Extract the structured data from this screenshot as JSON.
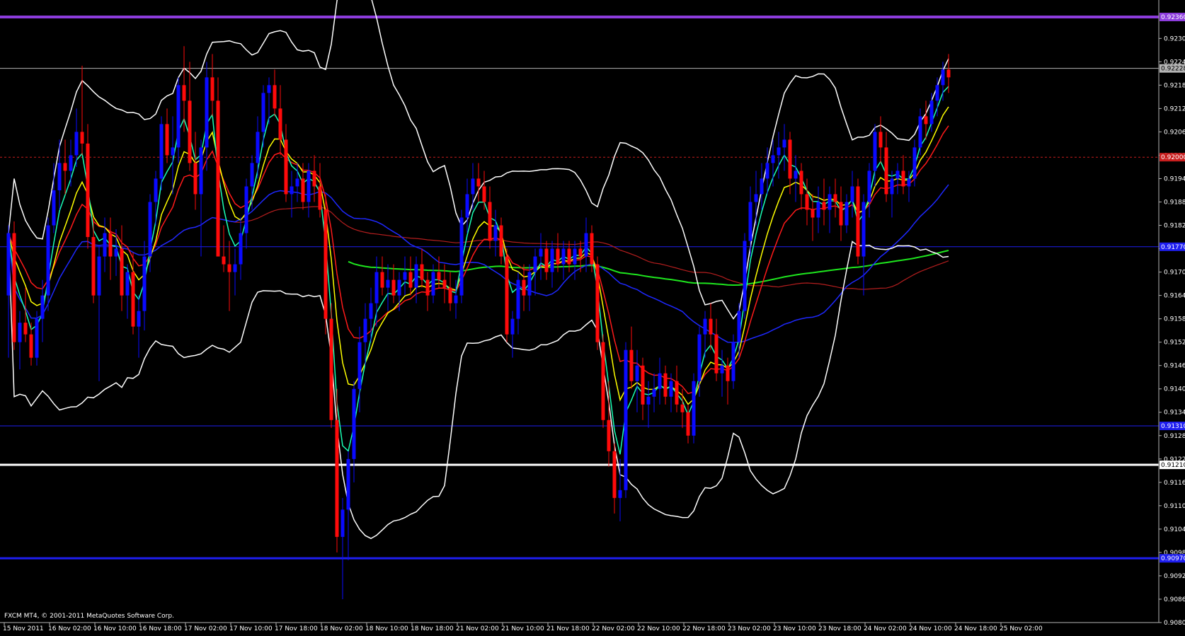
{
  "window": {
    "copyright": "FXCM MT4, © 2001-2011 MetaQuotes Software Corp."
  },
  "colors": {
    "background": "#000000",
    "bull_candle": "#0a0aff",
    "bear_candle": "#ff0a0a",
    "bollinger": "#ffffff",
    "ma_fast": "#19ffb4",
    "ma_yellow": "#ffff00",
    "ma_red": "#ff1a1a",
    "ma_blue": "#1e28ff",
    "ma_darkred": "#b41e1e",
    "ma_green": "#1ee61e",
    "level_purple": "#8c3cdc",
    "level_blue": "#1e1ef0",
    "level_white": "#ffffff",
    "level_reddash": "#c81e1e",
    "level_grey": "#b4b4b4",
    "axis_frame": "#b4b4b4"
  },
  "chart_data": {
    "type": "candlestick",
    "symbol": "",
    "ylim": [
      0.90805,
      0.924
    ],
    "yticks": [
      "0.92305",
      "0.92245",
      "0.92185",
      "0.92125",
      "0.92065",
      "0.92005",
      "0.91945",
      "0.91885",
      "0.91825",
      "0.91765",
      "0.91705",
      "0.91645",
      "0.91585",
      "0.91525",
      "0.91465",
      "0.91405",
      "0.91345",
      "0.91285",
      "0.91225",
      "0.91165",
      "0.91105",
      "0.91045",
      "0.90985",
      "0.90925",
      "0.90865",
      "0.90805"
    ],
    "xticks": [
      "15 Nov 2011",
      "16 Nov 02:00",
      "16 Nov 10:00",
      "16 Nov 18:00",
      "17 Nov 02:00",
      "17 Nov 10:00",
      "17 Nov 18:00",
      "18 Nov 02:00",
      "18 Nov 10:00",
      "18 Nov 18:00",
      "21 Nov 02:00",
      "21 Nov 10:00",
      "21 Nov 18:00",
      "22 Nov 02:00",
      "22 Nov 10:00",
      "22 Nov 18:00",
      "23 Nov 02:00",
      "23 Nov 10:00",
      "23 Nov 18:00",
      "24 Nov 02:00",
      "24 Nov 10:00",
      "24 Nov 18:00",
      "25 Nov 02:00"
    ],
    "bars_per_tick": 8,
    "candles": [
      [
        0.91645,
        0.91825,
        0.91485,
        0.91805
      ],
      [
        0.91805,
        0.91835,
        0.91505,
        0.91525
      ],
      [
        0.91525,
        0.91605,
        0.91455,
        0.91575
      ],
      [
        0.91575,
        0.91665,
        0.91525,
        0.91545
      ],
      [
        0.91545,
        0.91575,
        0.91465,
        0.91485
      ],
      [
        0.91485,
        0.91605,
        0.91465,
        0.91585
      ],
      [
        0.91585,
        0.91685,
        0.91525,
        0.91645
      ],
      [
        0.91645,
        0.91845,
        0.91605,
        0.91825
      ],
      [
        0.91825,
        0.91985,
        0.91805,
        0.91915
      ],
      [
        0.91915,
        0.92045,
        0.91865,
        0.91985
      ],
      [
        0.91985,
        0.92045,
        0.91905,
        0.91965
      ],
      [
        0.91965,
        0.92045,
        0.91925,
        0.92005
      ],
      [
        0.92005,
        0.92125,
        0.91975,
        0.92065
      ],
      [
        0.92065,
        0.92235,
        0.92005,
        0.92035
      ],
      [
        0.92035,
        0.92085,
        0.91765,
        0.91795
      ],
      [
        0.91795,
        0.91845,
        0.91625,
        0.91645
      ],
      [
        0.91645,
        0.91775,
        0.91425,
        0.91745
      ],
      [
        0.91745,
        0.91845,
        0.91705,
        0.91805
      ],
      [
        0.91805,
        0.91845,
        0.91685,
        0.91745
      ],
      [
        0.91745,
        0.91815,
        0.91695,
        0.91765
      ],
      [
        0.91765,
        0.91825,
        0.91605,
        0.91645
      ],
      [
        0.91645,
        0.91725,
        0.91585,
        0.91705
      ],
      [
        0.91705,
        0.91755,
        0.91545,
        0.91565
      ],
      [
        0.91565,
        0.91645,
        0.91485,
        0.91605
      ],
      [
        0.91605,
        0.91785,
        0.91555,
        0.91745
      ],
      [
        0.91745,
        0.91905,
        0.91705,
        0.91885
      ],
      [
        0.91885,
        0.91965,
        0.91825,
        0.91945
      ],
      [
        0.91945,
        0.92105,
        0.91915,
        0.92085
      ],
      [
        0.92085,
        0.92125,
        0.91985,
        0.92005
      ],
      [
        0.92005,
        0.92105,
        0.91905,
        0.92025
      ],
      [
        0.92025,
        0.92205,
        0.91985,
        0.92185
      ],
      [
        0.92185,
        0.92285,
        0.92065,
        0.92145
      ],
      [
        0.92145,
        0.92245,
        0.91965,
        0.91985
      ],
      [
        0.91985,
        0.92065,
        0.91865,
        0.91905
      ],
      [
        0.91905,
        0.92045,
        0.91745,
        0.92025
      ],
      [
        0.92025,
        0.92245,
        0.91965,
        0.92205
      ],
      [
        0.92205,
        0.92265,
        0.92105,
        0.92145
      ],
      [
        0.92145,
        0.92205,
        0.91765,
        0.91745
      ],
      [
        0.91745,
        0.91825,
        0.91705,
        0.91725
      ],
      [
        0.91725,
        0.91785,
        0.91605,
        0.91705
      ],
      [
        0.91705,
        0.91765,
        0.91645,
        0.91725
      ],
      [
        0.91725,
        0.91845,
        0.91685,
        0.91805
      ],
      [
        0.91805,
        0.91945,
        0.91765,
        0.91925
      ],
      [
        0.91925,
        0.92005,
        0.91865,
        0.91985
      ],
      [
        0.91985,
        0.92105,
        0.91945,
        0.92065
      ],
      [
        0.92065,
        0.92185,
        0.92025,
        0.92165
      ],
      [
        0.92165,
        0.92205,
        0.92085,
        0.92185
      ],
      [
        0.92185,
        0.92225,
        0.92105,
        0.92125
      ],
      [
        0.92125,
        0.92185,
        0.92005,
        0.92045
      ],
      [
        0.92045,
        0.92085,
        0.91885,
        0.91905
      ],
      [
        0.91905,
        0.91965,
        0.91845,
        0.91925
      ],
      [
        0.91925,
        0.91985,
        0.91885,
        0.91945
      ],
      [
        0.91945,
        0.91985,
        0.91865,
        0.91885
      ],
      [
        0.91885,
        0.91985,
        0.91845,
        0.91965
      ],
      [
        0.91965,
        0.92005,
        0.91885,
        0.91925
      ],
      [
        0.91925,
        0.91985,
        0.91845,
        0.91865
      ],
      [
        0.91865,
        0.91905,
        0.91545,
        0.91585
      ],
      [
        0.91585,
        0.91625,
        0.91305,
        0.91325
      ],
      [
        0.91325,
        0.91405,
        0.90985,
        0.91025
      ],
      [
        0.91025,
        0.91125,
        0.90865,
        0.91095
      ],
      [
        0.91095,
        0.91245,
        0.90965,
        0.91225
      ],
      [
        0.91225,
        0.91425,
        0.91165,
        0.91405
      ],
      [
        0.91405,
        0.91565,
        0.91345,
        0.91525
      ],
      [
        0.91525,
        0.91625,
        0.91465,
        0.91585
      ],
      [
        0.91585,
        0.91665,
        0.91525,
        0.91625
      ],
      [
        0.91625,
        0.91745,
        0.91565,
        0.91705
      ],
      [
        0.91705,
        0.91745,
        0.91645,
        0.91665
      ],
      [
        0.91665,
        0.91725,
        0.91605,
        0.91685
      ],
      [
        0.91685,
        0.91725,
        0.91625,
        0.91645
      ],
      [
        0.91645,
        0.91705,
        0.91605,
        0.91685
      ],
      [
        0.91685,
        0.91745,
        0.91645,
        0.91705
      ],
      [
        0.91705,
        0.91745,
        0.91645,
        0.91665
      ],
      [
        0.91665,
        0.91745,
        0.91625,
        0.91725
      ],
      [
        0.91725,
        0.91765,
        0.91665,
        0.91685
      ],
      [
        0.91685,
        0.91705,
        0.91605,
        0.91645
      ],
      [
        0.91645,
        0.91725,
        0.91625,
        0.91705
      ],
      [
        0.91705,
        0.91745,
        0.91665,
        0.91685
      ],
      [
        0.91685,
        0.91725,
        0.91625,
        0.91665
      ],
      [
        0.91665,
        0.91705,
        0.91605,
        0.91625
      ],
      [
        0.91625,
        0.91685,
        0.91585,
        0.91645
      ],
      [
        0.91645,
        0.91865,
        0.91625,
        0.91845
      ],
      [
        0.91845,
        0.91945,
        0.91805,
        0.91905
      ],
      [
        0.91905,
        0.91985,
        0.91865,
        0.91945
      ],
      [
        0.91945,
        0.91985,
        0.91885,
        0.91925
      ],
      [
        0.91925,
        0.91965,
        0.91865,
        0.91885
      ],
      [
        0.91885,
        0.91925,
        0.91765,
        0.91785
      ],
      [
        0.91785,
        0.91865,
        0.91745,
        0.91825
      ],
      [
        0.91825,
        0.91845,
        0.91725,
        0.91745
      ],
      [
        0.91745,
        0.91765,
        0.91525,
        0.91545
      ],
      [
        0.91545,
        0.91605,
        0.91485,
        0.91585
      ],
      [
        0.91585,
        0.91705,
        0.91545,
        0.91685
      ],
      [
        0.91685,
        0.91725,
        0.91605,
        0.91645
      ],
      [
        0.91645,
        0.91725,
        0.91605,
        0.91705
      ],
      [
        0.91705,
        0.91765,
        0.91645,
        0.91745
      ],
      [
        0.91745,
        0.91805,
        0.91685,
        0.91765
      ],
      [
        0.91765,
        0.91785,
        0.91685,
        0.91705
      ],
      [
        0.91705,
        0.91785,
        0.91665,
        0.91765
      ],
      [
        0.91765,
        0.91805,
        0.91705,
        0.91725
      ],
      [
        0.91725,
        0.91785,
        0.91685,
        0.91765
      ],
      [
        0.91765,
        0.91785,
        0.91705,
        0.91725
      ],
      [
        0.91725,
        0.91785,
        0.91685,
        0.91765
      ],
      [
        0.91765,
        0.91785,
        0.91705,
        0.91745
      ],
      [
        0.91745,
        0.91845,
        0.91705,
        0.91805
      ],
      [
        0.91805,
        0.91825,
        0.91705,
        0.91725
      ],
      [
        0.91725,
        0.91745,
        0.91505,
        0.91525
      ],
      [
        0.91525,
        0.91545,
        0.91305,
        0.91325
      ],
      [
        0.91325,
        0.91425,
        0.91205,
        0.91245
      ],
      [
        0.91245,
        0.91265,
        0.91085,
        0.91125
      ],
      [
        0.91125,
        0.91225,
        0.91065,
        0.91145
      ],
      [
        0.91145,
        0.91525,
        0.91125,
        0.91505
      ],
      [
        0.91505,
        0.91565,
        0.91405,
        0.91425
      ],
      [
        0.91425,
        0.91505,
        0.91345,
        0.91465
      ],
      [
        0.91465,
        0.91485,
        0.91325,
        0.91365
      ],
      [
        0.91365,
        0.91425,
        0.91305,
        0.91385
      ],
      [
        0.91385,
        0.91445,
        0.91345,
        0.91405
      ],
      [
        0.91405,
        0.91485,
        0.91365,
        0.91445
      ],
      [
        0.91445,
        0.91465,
        0.91365,
        0.91385
      ],
      [
        0.91385,
        0.91445,
        0.91345,
        0.91425
      ],
      [
        0.91425,
        0.91465,
        0.91345,
        0.91365
      ],
      [
        0.91365,
        0.91405,
        0.91305,
        0.91345
      ],
      [
        0.91345,
        0.91365,
        0.91265,
        0.91285
      ],
      [
        0.91285,
        0.91445,
        0.91265,
        0.91425
      ],
      [
        0.91425,
        0.91565,
        0.91385,
        0.91545
      ],
      [
        0.91545,
        0.91605,
        0.91485,
        0.91585
      ],
      [
        0.91585,
        0.91625,
        0.91505,
        0.91545
      ],
      [
        0.91545,
        0.91585,
        0.91425,
        0.91445
      ],
      [
        0.91445,
        0.91505,
        0.91385,
        0.91465
      ],
      [
        0.91465,
        0.91485,
        0.91365,
        0.91425
      ],
      [
        0.91425,
        0.91545,
        0.91405,
        0.91525
      ],
      [
        0.91525,
        0.91625,
        0.91485,
        0.91605
      ],
      [
        0.91605,
        0.91805,
        0.91585,
        0.91785
      ],
      [
        0.91785,
        0.91925,
        0.91745,
        0.91885
      ],
      [
        0.91885,
        0.91965,
        0.91825,
        0.91905
      ],
      [
        0.91905,
        0.91985,
        0.91865,
        0.91945
      ],
      [
        0.91945,
        0.92025,
        0.91905,
        0.91985
      ],
      [
        0.91985,
        0.92045,
        0.91925,
        0.92005
      ],
      [
        0.92005,
        0.92065,
        0.91945,
        0.92025
      ],
      [
        0.92025,
        0.92085,
        0.91965,
        0.92045
      ],
      [
        0.92045,
        0.92065,
        0.91905,
        0.91945
      ],
      [
        0.91945,
        0.92005,
        0.91885,
        0.91965
      ],
      [
        0.91965,
        0.91985,
        0.91865,
        0.91905
      ],
      [
        0.91905,
        0.91945,
        0.91825,
        0.91865
      ],
      [
        0.91865,
        0.91905,
        0.91785,
        0.91845
      ],
      [
        0.91845,
        0.91925,
        0.91805,
        0.91885
      ],
      [
        0.91885,
        0.91945,
        0.91825,
        0.91865
      ],
      [
        0.91865,
        0.91925,
        0.91805,
        0.91905
      ],
      [
        0.91905,
        0.91945,
        0.91845,
        0.91885
      ],
      [
        0.91885,
        0.91925,
        0.91785,
        0.91825
      ],
      [
        0.91825,
        0.91905,
        0.91805,
        0.91885
      ],
      [
        0.91885,
        0.91965,
        0.91845,
        0.91925
      ],
      [
        0.91925,
        0.91945,
        0.91725,
        0.91745
      ],
      [
        0.91745,
        0.91905,
        0.91645,
        0.91885
      ],
      [
        0.91885,
        0.91985,
        0.91845,
        0.91965
      ],
      [
        0.91965,
        0.92085,
        0.91925,
        0.92065
      ],
      [
        0.92065,
        0.92105,
        0.91985,
        0.92025
      ],
      [
        0.92025,
        0.92065,
        0.91885,
        0.91905
      ],
      [
        0.91905,
        0.91965,
        0.91845,
        0.91945
      ],
      [
        0.91945,
        0.91985,
        0.91905,
        0.91965
      ],
      [
        0.91965,
        0.92005,
        0.91905,
        0.91925
      ],
      [
        0.91925,
        0.91965,
        0.91885,
        0.91945
      ],
      [
        0.91945,
        0.92045,
        0.91925,
        0.92025
      ],
      [
        0.92025,
        0.92125,
        0.92005,
        0.92105
      ],
      [
        0.92105,
        0.92145,
        0.92045,
        0.92085
      ],
      [
        0.92085,
        0.92165,
        0.92065,
        0.92145
      ],
      [
        0.92145,
        0.92205,
        0.92105,
        0.92185
      ],
      [
        0.92185,
        0.92245,
        0.92145,
        0.92225
      ],
      [
        0.92225,
        0.92265,
        0.92165,
        0.92205
      ]
    ],
    "levels": [
      {
        "price": 0.9236,
        "color": "#8c3cdc",
        "width": 4,
        "dash": false,
        "label": "0.92360"
      },
      {
        "price": 0.92228,
        "color": "#b4b4b4",
        "width": 1,
        "dash": false,
        "label": "0.92228"
      },
      {
        "price": 0.92,
        "color": "#c81e1e",
        "width": 1,
        "dash": true,
        "label": "0.92000"
      },
      {
        "price": 0.9177,
        "color": "#1e1ef0",
        "width": 1,
        "dash": false,
        "label": "0.91770"
      },
      {
        "price": 0.9131,
        "color": "#1e1ef0",
        "width": 1,
        "dash": false,
        "label": "0.91310"
      },
      {
        "price": 0.9121,
        "color": "#ffffff",
        "width": 3,
        "dash": false,
        "label": "0.91210"
      },
      {
        "price": 0.9097,
        "color": "#1e1ef0",
        "width": 3,
        "dash": false,
        "label": "0.90970"
      }
    ]
  }
}
